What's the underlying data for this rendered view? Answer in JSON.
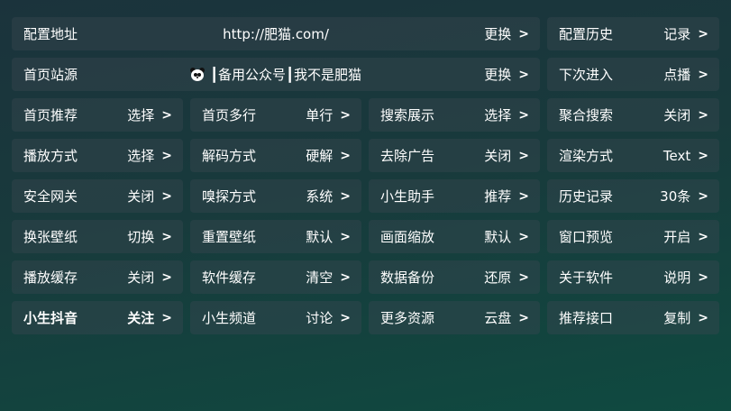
{
  "row1": {
    "config_addr": {
      "label": "配置地址",
      "url": "http://肥猫.com/",
      "action": "更换",
      "arrow": ">"
    },
    "config_history": {
      "label": "配置历史",
      "value": "记录",
      "arrow": ">"
    }
  },
  "row2": {
    "home_source": {
      "label": "首页站源",
      "text": "┃备用公众号┃我不是肥猫",
      "action": "更换",
      "arrow": ">"
    },
    "next_enter": {
      "label": "下次进入",
      "value": "点播",
      "arrow": ">"
    }
  },
  "settings": [
    {
      "label": "首页推荐",
      "value": "选择",
      "arrow": ">"
    },
    {
      "label": "首页多行",
      "value": "单行",
      "arrow": ">"
    },
    {
      "label": "搜索展示",
      "value": "选择",
      "arrow": ">"
    },
    {
      "label": "聚合搜索",
      "value": "关闭",
      "arrow": ">"
    },
    {
      "label": "播放方式",
      "value": "选择",
      "arrow": ">"
    },
    {
      "label": "解码方式",
      "value": "硬解",
      "arrow": ">"
    },
    {
      "label": "去除广告",
      "value": "关闭",
      "arrow": ">"
    },
    {
      "label": "渲染方式",
      "value": "Text",
      "arrow": ">"
    },
    {
      "label": "安全网关",
      "value": "关闭",
      "arrow": ">"
    },
    {
      "label": "嗅探方式",
      "value": "系统",
      "arrow": ">"
    },
    {
      "label": "小生助手",
      "value": "推荐",
      "arrow": ">"
    },
    {
      "label": "历史记录",
      "value": "30条",
      "arrow": ">"
    },
    {
      "label": "换张壁纸",
      "value": "切换",
      "arrow": ">"
    },
    {
      "label": "重置壁纸",
      "value": "默认",
      "arrow": ">"
    },
    {
      "label": "画面缩放",
      "value": "默认",
      "arrow": ">"
    },
    {
      "label": "窗口预览",
      "value": "开启",
      "arrow": ">"
    },
    {
      "label": "播放缓存",
      "value": "关闭",
      "arrow": ">"
    },
    {
      "label": "软件缓存",
      "value": "清空",
      "arrow": ">"
    },
    {
      "label": "数据备份",
      "value": "还原",
      "arrow": ">"
    },
    {
      "label": "关于软件",
      "value": "说明",
      "arrow": ">"
    },
    {
      "label": "小生抖音",
      "value": "关注",
      "arrow": ">"
    },
    {
      "label": "小生频道",
      "value": "讨论",
      "arrow": ">"
    },
    {
      "label": "更多资源",
      "value": "云盘",
      "arrow": ">"
    },
    {
      "label": "推荐接口",
      "value": "复制",
      "arrow": ">"
    }
  ],
  "icons": {
    "panda": "panda-icon"
  }
}
